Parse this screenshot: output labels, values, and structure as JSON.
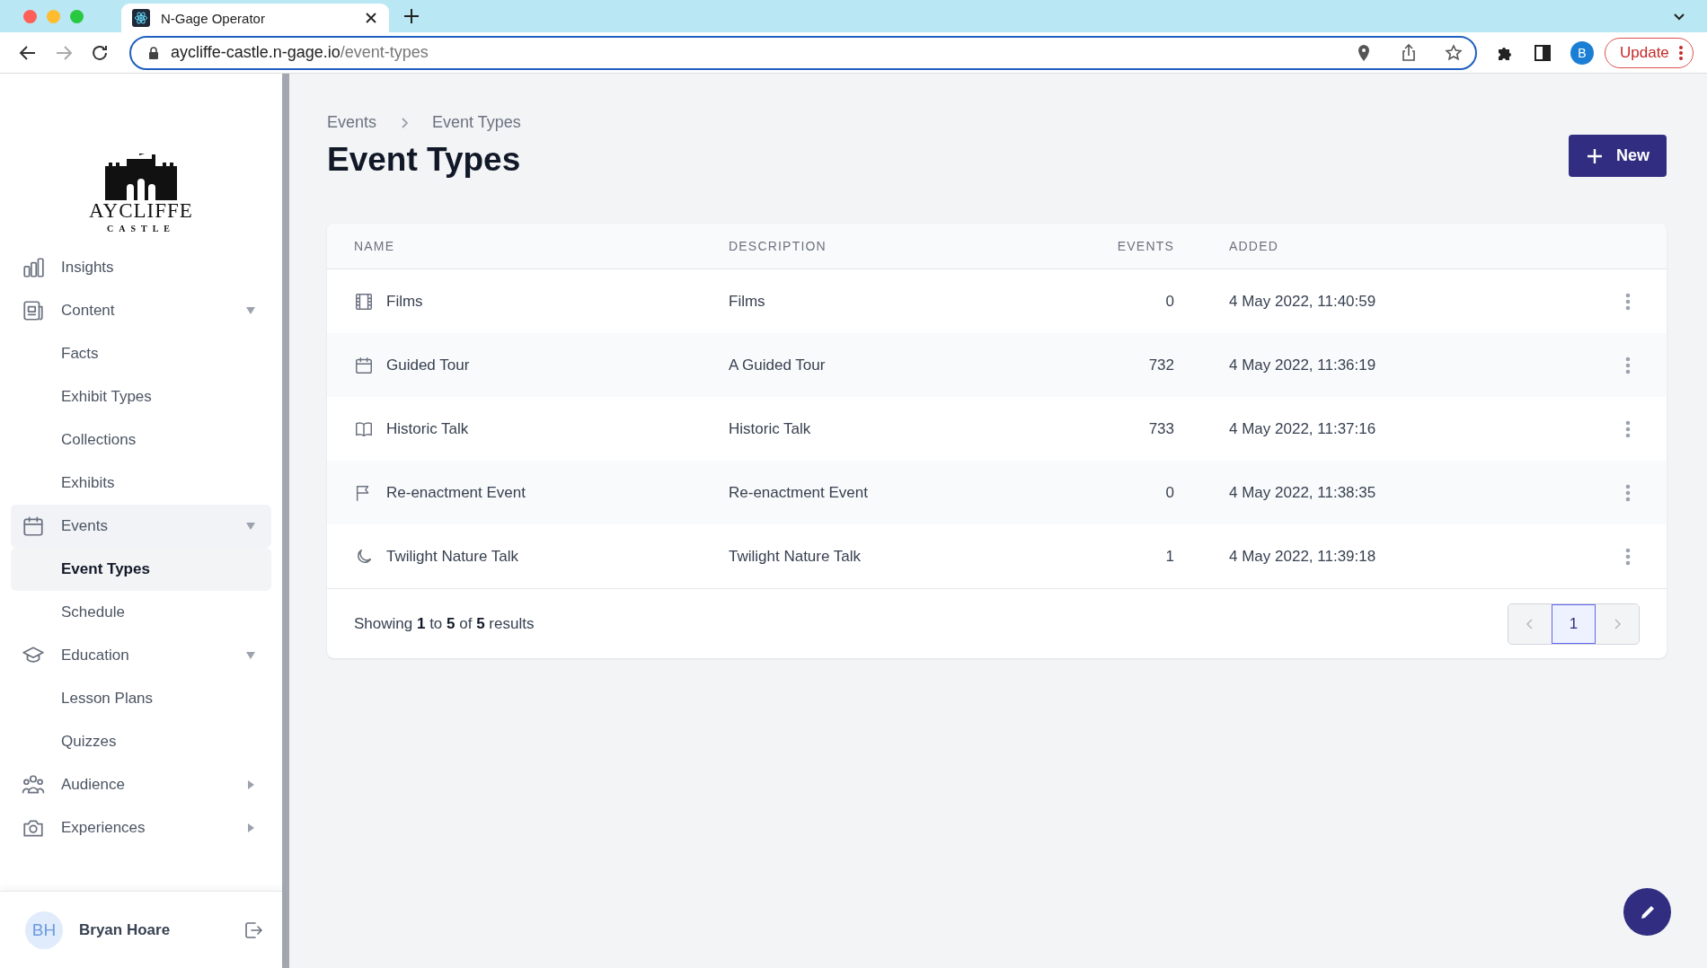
{
  "browser": {
    "tabs": [
      {
        "title": "N-Gage Operator",
        "selected": true
      }
    ],
    "url_host": "aycliffe-castle.n-gage.io",
    "url_path": "/event-types",
    "profile": "B",
    "update_label": "Update"
  },
  "logo": {
    "name": "AYCLIFFE",
    "sub": "CASTLE"
  },
  "sidebar": {
    "items": [
      {
        "label": "Insights",
        "kind": "link",
        "selected": false
      },
      {
        "label": "Content",
        "kind": "group",
        "expanded": true,
        "selected": false,
        "children": [
          {
            "label": "Facts",
            "selected": false
          },
          {
            "label": "Exhibit Types",
            "selected": false
          },
          {
            "label": "Collections",
            "selected": false
          },
          {
            "label": "Exhibits",
            "selected": false
          }
        ]
      },
      {
        "label": "Events",
        "kind": "group",
        "expanded": true,
        "selected": true,
        "children": [
          {
            "label": "Event Types",
            "selected": true
          },
          {
            "label": "Schedule",
            "selected": false
          }
        ]
      },
      {
        "label": "Education",
        "kind": "group",
        "expanded": true,
        "selected": false,
        "children": [
          {
            "label": "Lesson Plans",
            "selected": false
          },
          {
            "label": "Quizzes",
            "selected": false
          }
        ]
      },
      {
        "label": "Audience",
        "kind": "group",
        "expanded": false,
        "selected": false
      },
      {
        "label": "Experiences",
        "kind": "group",
        "expanded": false,
        "selected": false
      }
    ],
    "user": {
      "initials": "BH",
      "name": "Bryan Hoare"
    }
  },
  "breadcrumb": [
    "Events",
    "Event Types"
  ],
  "title": "Event Types",
  "new_button": "New",
  "table": {
    "columns": [
      "NAME",
      "DESCRIPTION",
      "EVENTS",
      "ADDED"
    ],
    "rows": [
      {
        "name": "Films",
        "description": "Films",
        "events": "0",
        "added": "4 May 2022, 11:40:59"
      },
      {
        "name": "Guided Tour",
        "description": "A Guided Tour",
        "events": "732",
        "added": "4 May 2022, 11:36:19"
      },
      {
        "name": "Historic Talk",
        "description": "Historic Talk",
        "events": "733",
        "added": "4 May 2022, 11:37:16"
      },
      {
        "name": "Re-enactment Event",
        "description": "Re-enactment Event",
        "events": "0",
        "added": "4 May 2022, 11:38:35"
      },
      {
        "name": "Twilight Nature Talk",
        "description": "Twilight Nature Talk",
        "events": "1",
        "added": "4 May 2022, 11:39:18"
      }
    ],
    "summary": "Showing **1** to **5** of **5** results",
    "pages": [
      {
        "label": "1",
        "selected": true
      }
    ]
  }
}
